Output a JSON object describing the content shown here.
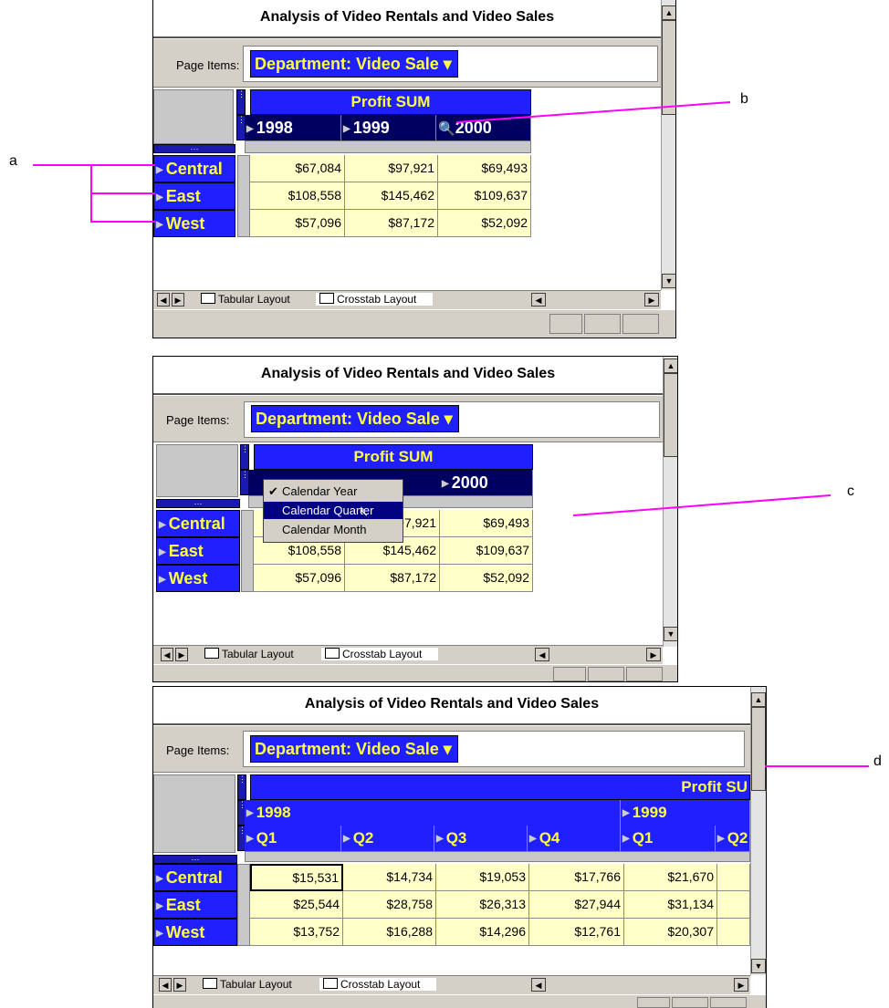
{
  "window": {
    "title": "Analysis of Video Rentals and Video Sales",
    "page_items_label": "Page Items:",
    "page_item_value": "Department: Video Sale ▾"
  },
  "measure": {
    "label": "Profit SUM",
    "label_truncated": "Profit SU"
  },
  "years": [
    "1998",
    "1999",
    "2000"
  ],
  "quarters": [
    "Q1",
    "Q2",
    "Q3",
    "Q4",
    "Q1",
    "Q2"
  ],
  "rows": [
    "Central",
    "East",
    "West"
  ],
  "table1": [
    [
      "$67,084",
      "$97,921",
      "$69,493"
    ],
    [
      "$108,558",
      "$145,462",
      "$109,637"
    ],
    [
      "$57,096",
      "$87,172",
      "$52,092"
    ]
  ],
  "table2_visible": [
    [
      "",
      "$97,921",
      "$69,493"
    ],
    [
      "$108,558",
      "$145,462",
      "$109,637"
    ],
    [
      "$57,096",
      "$87,172",
      "$52,092"
    ]
  ],
  "table3": [
    [
      "$15,531",
      "$14,734",
      "$19,053",
      "$17,766",
      "$21,670"
    ],
    [
      "$25,544",
      "$28,758",
      "$26,313",
      "$27,944",
      "$31,134"
    ],
    [
      "$13,752",
      "$16,288",
      "$14,296",
      "$12,761",
      "$20,307"
    ]
  ],
  "tabs": {
    "tabular": "Tabular Layout",
    "crosstab": "Crosstab Layout"
  },
  "menu": {
    "items": [
      "Calendar Year",
      "Calendar Quarter",
      "Calendar Month"
    ],
    "checked": "Calendar Year",
    "highlighted": "Calendar Quarter"
  },
  "callouts": {
    "a": "a",
    "b": "b",
    "c": "c",
    "d": "d"
  },
  "colors": {
    "header_blue": "#2020ff",
    "header_text": "#ffff40",
    "cell_bg": "#ffffc8",
    "callout_line": "#ff00ff"
  }
}
